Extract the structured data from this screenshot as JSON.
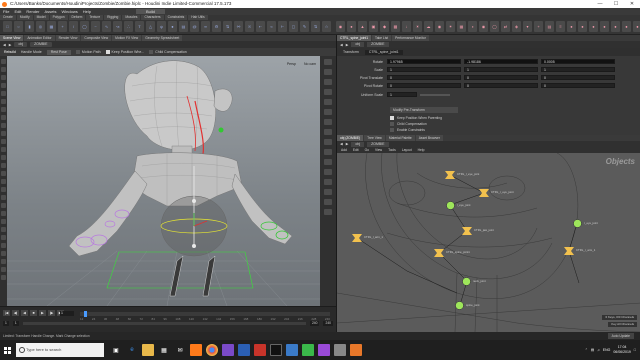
{
  "window": {
    "title": "C:/Users/Banks/Documents/HoudiniProjects/Zombie/Zombie.hiplc - Houdini Indie Limited-Commercial 17.5.173",
    "controls": [
      "minimize",
      "maximize",
      "close"
    ]
  },
  "menubar": [
    "File",
    "Edit",
    "Render",
    "Assets",
    "Windows",
    "Help",
    "Build"
  ],
  "shelf": {
    "tabs": [
      "Create",
      "Modify",
      "Model",
      "Polygon",
      "Deform",
      "Texture",
      "Rigging",
      "Muscles",
      "Characters",
      "Constraints",
      "Hair Utils",
      "Guide Process",
      "Terrain FX",
      "Simple FX",
      "Cloud FX",
      "Volume"
    ],
    "right_tabs": [
      "Lights and Cameras",
      "Collisions",
      "Particles",
      "Grains",
      "Vellum",
      "Rigid Bodies",
      "Particle Fluids",
      "Viscous Fluids",
      "Oceans",
      "Fluid Containers",
      "Populate Containers",
      "Container Tools",
      "Pyro FX",
      "Sparse Pyro FX",
      "FEM",
      "Wires",
      "Crowds",
      "Drive Simulation"
    ],
    "right_icons": [
      "Camera",
      "Point Light",
      "Spot Light",
      "Area Light",
      "Geometry Light",
      "Volume Light",
      "Distant Light",
      "Environment Light",
      "Sky Light",
      "GI Light",
      "Caustic Light",
      "Portal Light",
      "Ambient Light",
      "Stereo Camera",
      "VR Camera",
      "Switcher",
      "Gamepad Camera"
    ]
  },
  "left_pane": {
    "tabs": [
      "Scene View",
      "Animation Editor",
      "Render View",
      "Composite View",
      "Motion FX View",
      "Geometry Spreadsheet"
    ],
    "active_tab": "Scene View",
    "path": [
      "obj",
      "ZOMBIE"
    ],
    "tool_options": {
      "tool": "Rebuild",
      "handle_mode": "Handle Mode",
      "handle_mode_value": "Rest Pose",
      "motion_path": "Motion Path",
      "keep_position": "Keep Position Whe...",
      "child_comp": "Child Compensation"
    },
    "viewport_labels": {
      "persp": "Persp",
      "cam": "No cam"
    },
    "status": "Limited: Transform Handle Change. Mark Change selection"
  },
  "timeline": {
    "frame": "1",
    "ticks": [
      "12",
      "24",
      "36",
      "48",
      "60",
      "72",
      "84",
      "96",
      "108",
      "120",
      "132",
      "144",
      "156",
      "168",
      "180",
      "192",
      "204",
      "216",
      "228",
      "240"
    ],
    "range_start": "1",
    "range_inner_start": "1",
    "range_inner_end": "240",
    "range_end": "240"
  },
  "param_pane": {
    "tabs": [
      "CTRL_spine_joint1",
      "Take List",
      "Performance Monitor"
    ],
    "path": [
      "obj",
      "ZOMBIE"
    ],
    "header": {
      "type": "Transform",
      "name": "CTRL_spine_joint1"
    },
    "rows": [
      {
        "label": "Rotate",
        "values": [
          "1.97965",
          "-1.98186",
          "0.0005"
        ]
      },
      {
        "label": "Scale",
        "values": [
          "1",
          "1",
          "1"
        ]
      },
      {
        "label": "Pivot Translate",
        "values": [
          "0",
          "0",
          "0"
        ]
      },
      {
        "label": "Pivot Rotate",
        "values": [
          "0",
          "0",
          "0"
        ]
      },
      {
        "label": "Uniform Scale",
        "values": [
          "1"
        ]
      }
    ],
    "modify_button": "Modify Pre-Transform",
    "checks": [
      {
        "label": "Keep Position When Parenting",
        "on": true
      },
      {
        "label": "Child Compensation",
        "on": false
      },
      {
        "label": "Enable Constraints",
        "on": false
      }
    ]
  },
  "net_pane": {
    "tabs": [
      "obj (ZOMBIE)",
      "Tree View",
      "Material Palette",
      "Asset Browser"
    ],
    "active_tab": "obj (ZOMBIE)",
    "path": [
      "obj",
      "ZOMBIE"
    ],
    "menu": [
      "Add",
      "Edit",
      "Go",
      "View",
      "Tools",
      "Layout",
      "Help"
    ],
    "context_label": "Objects",
    "nodes": [
      {
        "label": "CTRL_l_eye_joint",
        "kind": "bone"
      },
      {
        "label": "CTRL_r_eye_joint",
        "kind": "bone"
      },
      {
        "label": "l_eye_joint",
        "kind": "null"
      },
      {
        "label": "r_eye_joint",
        "kind": "null"
      },
      {
        "label": "CTRL_jaw_joint",
        "kind": "bone"
      },
      {
        "label": "CTRL_l_arm_1",
        "kind": "bone"
      },
      {
        "label": "CTRL_r_arm_1",
        "kind": "bone"
      },
      {
        "label": "CTRL_spine_joint1",
        "kind": "bone"
      },
      {
        "label": "neck_joint",
        "kind": "null"
      },
      {
        "label": "spine_joint",
        "kind": "null"
      }
    ],
    "status_top": "0 Keys, 0/0 Channels",
    "status_bottom": "Key All Channels",
    "auto_update": "Auto Update"
  },
  "taskbar": {
    "search_placeholder": "Type here to search",
    "time": "17:04",
    "date": "06/06/2019",
    "lang": "ENG"
  },
  "colors": {
    "accent": "#ff7a1a",
    "viewport_bg": "#8e9499",
    "node_bone": "#f2c14e",
    "node_null": "#9ee65b",
    "select_blue": "#4a9cff"
  }
}
